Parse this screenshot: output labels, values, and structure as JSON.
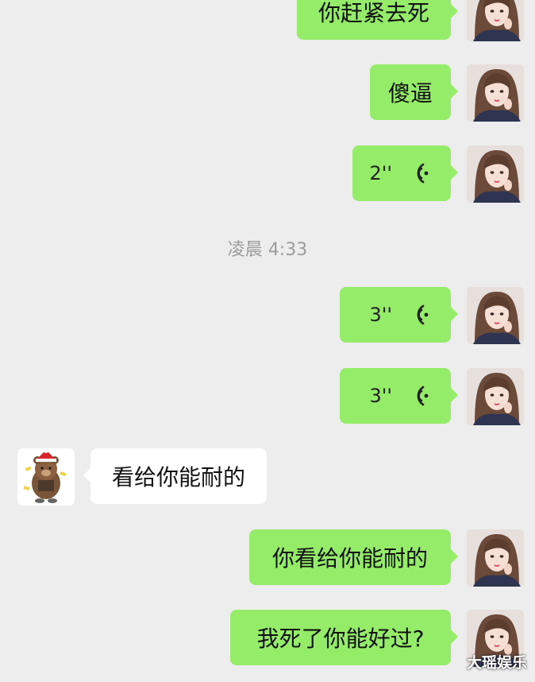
{
  "chat": {
    "timestamp": "凌晨 4:33",
    "messages": [
      {
        "side": "out",
        "type": "text",
        "text": "你赶紧去死"
      },
      {
        "side": "out",
        "type": "text",
        "text": "傻逼"
      },
      {
        "side": "out",
        "type": "voice",
        "duration": "2''"
      },
      {
        "side": "out",
        "type": "voice",
        "duration": "3''"
      },
      {
        "side": "out",
        "type": "voice",
        "duration": "3''"
      },
      {
        "side": "in",
        "type": "text",
        "text": "看给你能耐的"
      },
      {
        "side": "out",
        "type": "text",
        "text": "你看给你能耐的"
      },
      {
        "side": "out",
        "type": "text",
        "text": "我死了你能好过?"
      }
    ]
  },
  "watermark": "大瑶娱乐",
  "colors": {
    "background": "#ededed",
    "outgoing_bubble": "#95ec69",
    "incoming_bubble": "#ffffff",
    "timestamp_text": "#9c9c9c"
  },
  "icons": {
    "voice": "voice-wave-icon",
    "self_avatar": "girl-avatar",
    "other_avatar": "bear-avatar"
  }
}
